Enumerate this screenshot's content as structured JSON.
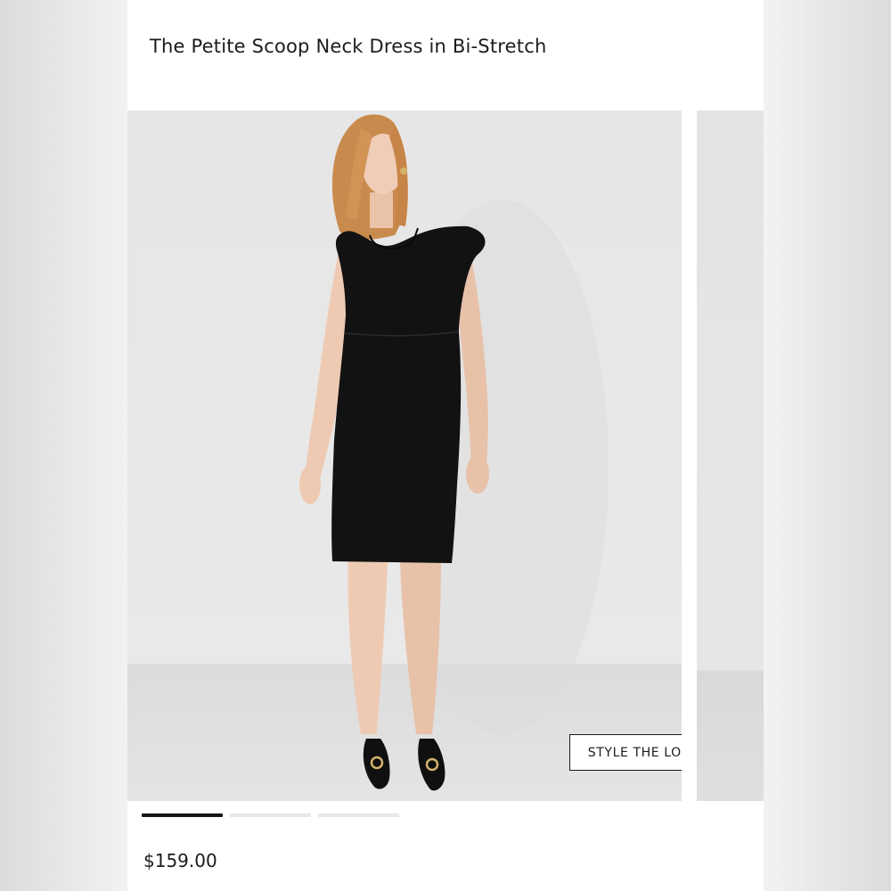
{
  "product": {
    "title": "The Petite Scoop Neck Dress in Bi-Stretch",
    "price": "$159.00",
    "image_alt": "Model wearing black scoop neck sheath dress with black pointed heels"
  },
  "carousel": {
    "cta_label": "STYLE THE LOOK",
    "slide_count": 3,
    "active_index": 0
  },
  "colors": {
    "dress": "#111111",
    "background": "#e6e6e6",
    "active_indicator": "#151515",
    "inactive_indicator": "#e7e7e7"
  }
}
